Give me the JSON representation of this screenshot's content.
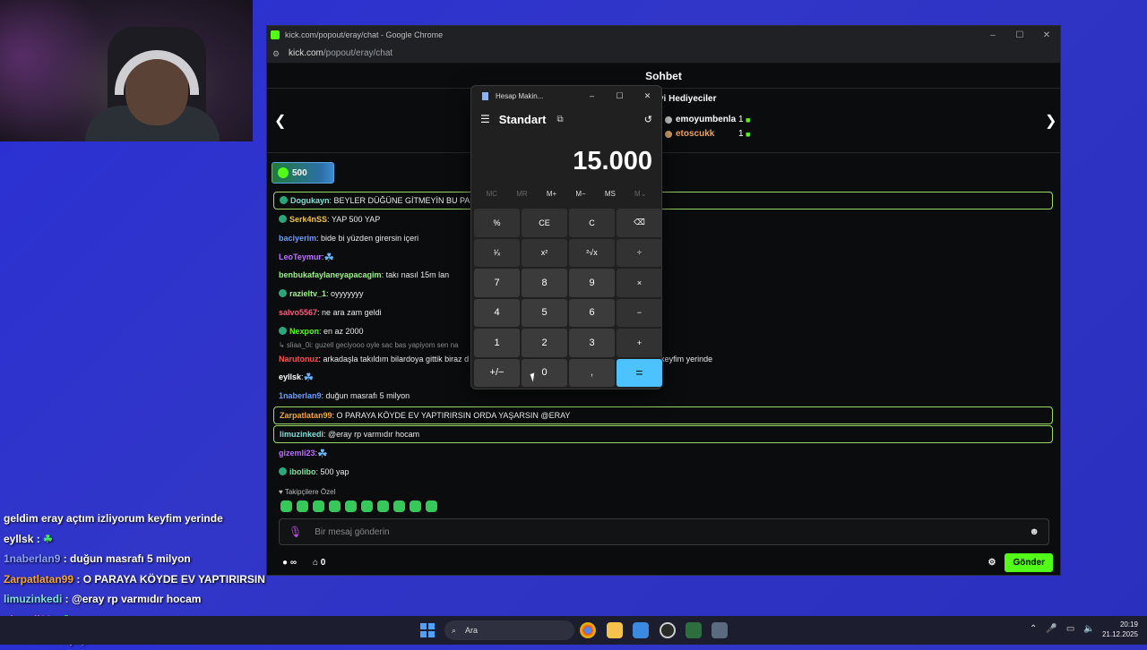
{
  "browser": {
    "title": "kick.com/popout/eray/chat - Google Chrome",
    "url_domain": "kick.com",
    "url_path": "/popout/eray/chat",
    "controls": [
      "–",
      "☐",
      "✕"
    ]
  },
  "chat": {
    "header": "Sohbet",
    "gifters_title": "yi Hediyeciler",
    "gifters": [
      {
        "name": "emoyumbenla",
        "count": "1",
        "color": "#ffffff"
      },
      {
        "name": "etoscukk",
        "count": "1",
        "color": "#f0a15a"
      }
    ],
    "goal_value": "500",
    "messages": [
      {
        "user": "Dogukayn",
        "text": ": BEYLER DÜĞÜNE GİTMEYİN BU PARA",
        "color": "#7ee0d8",
        "badge": true,
        "highlight": true
      },
      {
        "user": "Serk4nSS",
        "text": ": YAP 500 YAP",
        "color": "#f2c14e",
        "badge": true
      },
      {
        "user": "baciyerim",
        "text": ": bide bi yüzden girersin içeri",
        "color": "#6b9bff"
      },
      {
        "user": "LeoTeymur",
        "text": ":",
        "color": "#c06cff",
        "emote": true
      },
      {
        "user": "benbukafaylaneyapacagim",
        "text": ": takı nasıl 15m lan",
        "color": "#9ef28a"
      },
      {
        "user": "razieltv_1",
        "text": ": oyyyyyyy",
        "color": "#9ef28a",
        "badge": true
      },
      {
        "user": "salvo5567",
        "text": ": ne ara zam geldi",
        "color": "#ff5b7a"
      },
      {
        "user": "Nexpon",
        "text": ": en az 2000",
        "color": "#53fc18",
        "badge": true
      },
      {
        "reply": true,
        "text": "↳ sliaa_0i: guzell geciyooo oyle sac bas yapiyom sen na"
      },
      {
        "user": "Narutonuz",
        "text": ": arkadaşla takıldım bilardoya gittik biraz d",
        "color": "#ff5050",
        "tail": "keyfim yerinde"
      },
      {
        "user": "eyllsk",
        "text": ":",
        "color": "#ffffff",
        "emote": true
      },
      {
        "user": "1naberlan9",
        "text": ": duğun masrafı 5 milyon",
        "color": "#6b9bff"
      },
      {
        "user": "Zarpatlatan99",
        "text": ": O PARAYA KÖYDE EV YAPTIRIRSIN ORDA YAŞARSIN @ERAY",
        "color": "#f2a33a",
        "highlight": true
      },
      {
        "user": "limuzinkedi",
        "text": ": @eray rp varmıdır hocam",
        "color": "#7ee0d8",
        "highlight": true
      },
      {
        "user": "gizemli23",
        "text": ":",
        "color": "#c06cff",
        "emote": true
      },
      {
        "user": "ibolibo",
        "text": ": 500 yap",
        "color": "#7ee0a0",
        "badge": true
      }
    ],
    "followers_only": "Takipçilere Özel",
    "input_placeholder": "Bir mesaj gönderin",
    "infinity": "∞",
    "gift_count": "0",
    "send_label": "Gönder"
  },
  "calculator": {
    "title": "Hesap Makin...",
    "mode": "Standart",
    "display": "15.000",
    "memory": [
      "MC",
      "MR",
      "M+",
      "M−",
      "MS",
      "M⌄"
    ],
    "keys": [
      "%",
      "CE",
      "C",
      "⌫",
      "¹⁄ₓ",
      "x²",
      "²√x",
      "÷",
      "7",
      "8",
      "9",
      "×",
      "4",
      "5",
      "6",
      "−",
      "1",
      "2",
      "3",
      "+",
      "+/−",
      "0",
      ",",
      "="
    ]
  },
  "stream_overlay": [
    {
      "user": "",
      "text": "geldim eray açtım izliyorum keyfim yerinde",
      "color": "#ffffff"
    },
    {
      "user": "eyllsk",
      "text": " : ",
      "color": "#ffffff",
      "emote": true
    },
    {
      "user": "1naberlan9",
      "text": " : duğun masrafı 5 milyon",
      "color": "#8aa0ff"
    },
    {
      "user": "Zarpatlatan99",
      "text": " : O PARAYA KÖYDE EV YAPTIRIRSIN",
      "color": "#f2a33a"
    },
    {
      "user": "limuzinkedi",
      "text": " : @eray rp varmıdır hocam",
      "color": "#7ee0d8"
    },
    {
      "user": "gizemli23",
      "text": " : ",
      "color": "#c06cff",
      "emote": true
    },
    {
      "user": "ibolibo",
      "text": " : 500 yap",
      "color": "#7ee0a0"
    }
  ],
  "taskbar": {
    "search_label": "Ara",
    "time": "20:19",
    "date": "21.12.2025"
  }
}
